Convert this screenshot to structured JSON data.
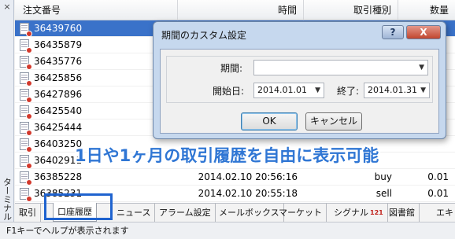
{
  "side": {
    "close_glyph": "×",
    "label": "ターミナル"
  },
  "table": {
    "headers": {
      "order": "注文番号",
      "time": "時間",
      "type": "取引種別",
      "qty": "数量"
    },
    "rows": [
      {
        "order": "36439760",
        "time": "",
        "type": "",
        "qty": "",
        "selected": true
      },
      {
        "order": "36435879",
        "time": "",
        "type": "",
        "qty": ""
      },
      {
        "order": "36435776",
        "time": "",
        "type": "",
        "qty": ""
      },
      {
        "order": "36425856",
        "time": "",
        "type": "",
        "qty": ""
      },
      {
        "order": "36427896",
        "time": "",
        "type": "",
        "qty": ""
      },
      {
        "order": "36425540",
        "time": "",
        "type": "",
        "qty": ""
      },
      {
        "order": "36425444",
        "time": "",
        "type": "",
        "qty": ""
      },
      {
        "order": "36403250",
        "time": "",
        "type": "",
        "qty": ""
      },
      {
        "order": "36402911",
        "time": "",
        "type": "",
        "qty": ""
      },
      {
        "order": "36385228",
        "time": "2014.02.10 20:56:16",
        "type": "buy",
        "qty": "0.01"
      },
      {
        "order": "36385231",
        "time": "2014.02.10 20:55:18",
        "type": "sell",
        "qty": "0.01"
      }
    ]
  },
  "tabs": [
    {
      "label": "取引"
    },
    {
      "label": "口座履歴",
      "active": true
    },
    {
      "label": "ニュース"
    },
    {
      "label": "アラーム設定"
    },
    {
      "label": "メールボックス"
    },
    {
      "label": "マーケット"
    },
    {
      "label": "シグナル",
      "badge": "121"
    },
    {
      "label": "図書館"
    },
    {
      "label": "エキ"
    }
  ],
  "status": {
    "text": "F1キーでヘルプが表示されます"
  },
  "dialog": {
    "title": "期間のカスタム設定",
    "help_label": "?",
    "close_label": "X",
    "period_label": "期間:",
    "period_value": "",
    "start_label": "開始日:",
    "start_value": "2014.01.01",
    "end_label": "終了:",
    "end_value": "2014.01.31",
    "ok_label": "OK",
    "cancel_label": "キャンセル"
  },
  "promo": {
    "text": "1日や1ヶ月の取引履歴を自由に表示可能"
  },
  "colors": {
    "selection": "#3a72c9",
    "highlight_border": "#1f63cf",
    "promo_text": "#2f76d4",
    "badge": "#c0201a"
  }
}
